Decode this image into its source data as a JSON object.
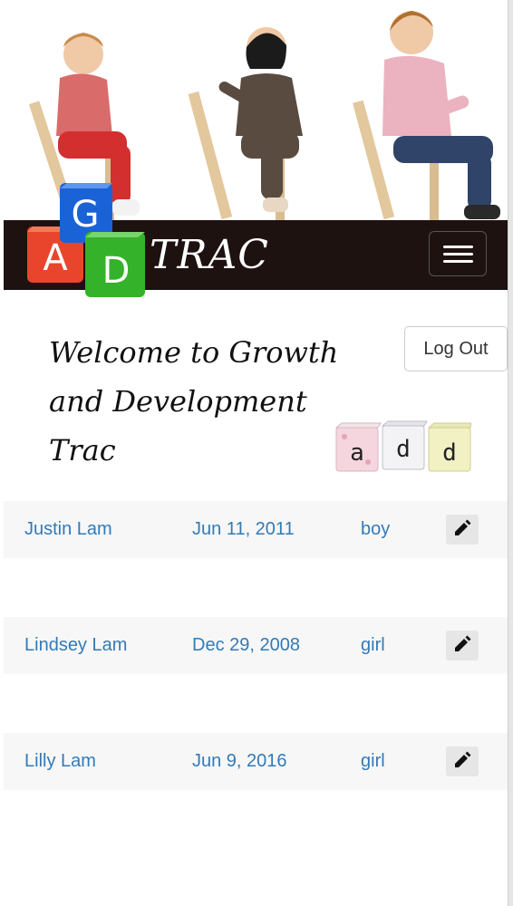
{
  "header": {
    "brand": "TRAC",
    "logo_letters": [
      "A",
      "G",
      "D"
    ]
  },
  "welcome": {
    "line1": "Welcome to Growth",
    "line2": "and Development Trac"
  },
  "actions": {
    "logout_label": "Log Out",
    "add_letters": [
      "a",
      "d",
      "d"
    ]
  },
  "children": [
    {
      "name": "Justin Lam",
      "birthdate": "Jun 11, 2011",
      "gender": "boy"
    },
    {
      "name": "Lindsey Lam",
      "birthdate": "Dec 29, 2008",
      "gender": "girl"
    },
    {
      "name": "Lilly Lam",
      "birthdate": "Jun 9, 2016",
      "gender": "girl"
    }
  ],
  "icons": {
    "menu": "hamburger-icon",
    "edit": "pencil-icon"
  },
  "colors": {
    "navbar": "#1e1211",
    "link": "#337ab7",
    "row_bg": "#f7f7f7",
    "block_red": "#e8452c",
    "block_blue": "#1a63d6",
    "block_green": "#34b229"
  }
}
